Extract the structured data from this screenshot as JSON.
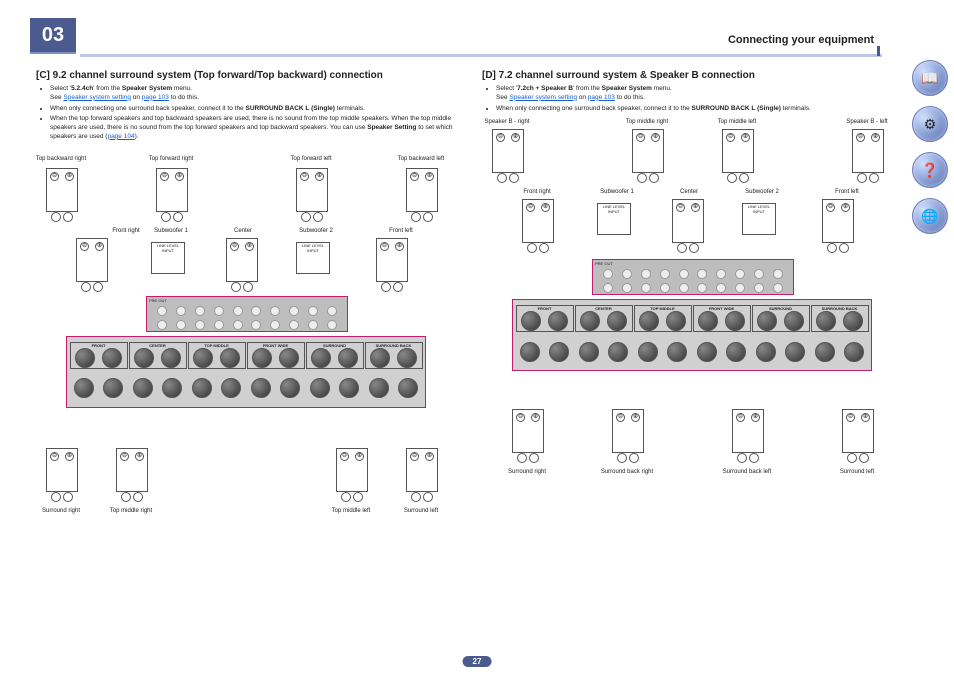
{
  "header": {
    "chapter_num": "03",
    "section": "Connecting your equipment",
    "page_number": "27"
  },
  "left": {
    "title": "[C] 9.2 channel surround system (Top forward/Top backward) connection",
    "b1_a": "Select '",
    "b1_b": "5.2.4ch",
    "b1_c": "' from the ",
    "b1_d": "Speaker System",
    "b1_e": " menu.",
    "b1_note": "See ",
    "b1_link": "Speaker system setting",
    "b1_note2": " on ",
    "b1_link2": "page 103",
    "b1_note3": " to do this.",
    "b2_a": "When only connecting one surround back speaker, connect it to the ",
    "b2_b": "SURROUND BACK L (Single)",
    "b2_c": " terminals.",
    "b3_a": "When the top forward speakers and top backward speakers are used, there is no sound from the top middle speakers. When the top middle speakers are used, there is no sound from the top forward speakers and top backward speakers. You can use ",
    "b3_b": "Speaker Setting",
    "b3_c": " to set which speakers are used (",
    "b3_link": "page 104",
    "b3_d": ").",
    "labels": {
      "tbw_r": "Top backward right",
      "tfw_r": "Top forward right",
      "tfw_l": "Top forward left",
      "tbw_l": "Top backward left",
      "fr": "Front right",
      "sw1": "Subwoofer 1",
      "ctr": "Center",
      "sw2": "Subwoofer 2",
      "fl": "Front left",
      "sr": "Surround right",
      "tmr": "Top middle right",
      "tml": "Top middle left",
      "sl": "Surround left",
      "preout": "PRE OUT",
      "groups": [
        "FRONT",
        "CENTER",
        "TOP MIDDLE",
        "FRONT WIDE",
        "SURROUND",
        "SURROUND BACK"
      ],
      "line_level": "LINE LEVEL INPUT"
    }
  },
  "right": {
    "title": "[D] 7.2 channel surround system & Speaker B connection",
    "b1_a": "Select '",
    "b1_b": "7.2ch + Speaker B",
    "b1_c": "' from the ",
    "b1_d": "Speaker System",
    "b1_e": " menu.",
    "b1_note": "See ",
    "b1_link": "Speaker system setting",
    "b1_note2": " on ",
    "b1_link2": "page 103",
    "b1_note3": " to do this.",
    "b2_a": "When only connecting one surround back speaker, connect it to the ",
    "b2_b": "SURROUND BACK L (Single)",
    "b2_c": " terminals.",
    "labels": {
      "sbR": "Speaker B - right",
      "tmr": "Top middle right",
      "tml": "Top middle left",
      "sbL": "Speaker B - left",
      "fr": "Front right",
      "sw1": "Subwoofer 1",
      "ctr": "Center",
      "sw2": "Subwoofer 2",
      "fl": "Front left",
      "sr": "Surround right",
      "sbr": "Surround back right",
      "sbl": "Surround back left",
      "sl": "Surround left",
      "preout": "PRE OUT",
      "groups": [
        "FRONT",
        "CENTER",
        "TOP MIDDLE",
        "FRONT WIDE",
        "SURROUND",
        "SURROUND BACK"
      ],
      "line_level": "LINE LEVEL INPUT"
    }
  },
  "sidebar": {
    "book": "📖",
    "setup": "⚙",
    "help": "❓",
    "net": "🌐"
  }
}
